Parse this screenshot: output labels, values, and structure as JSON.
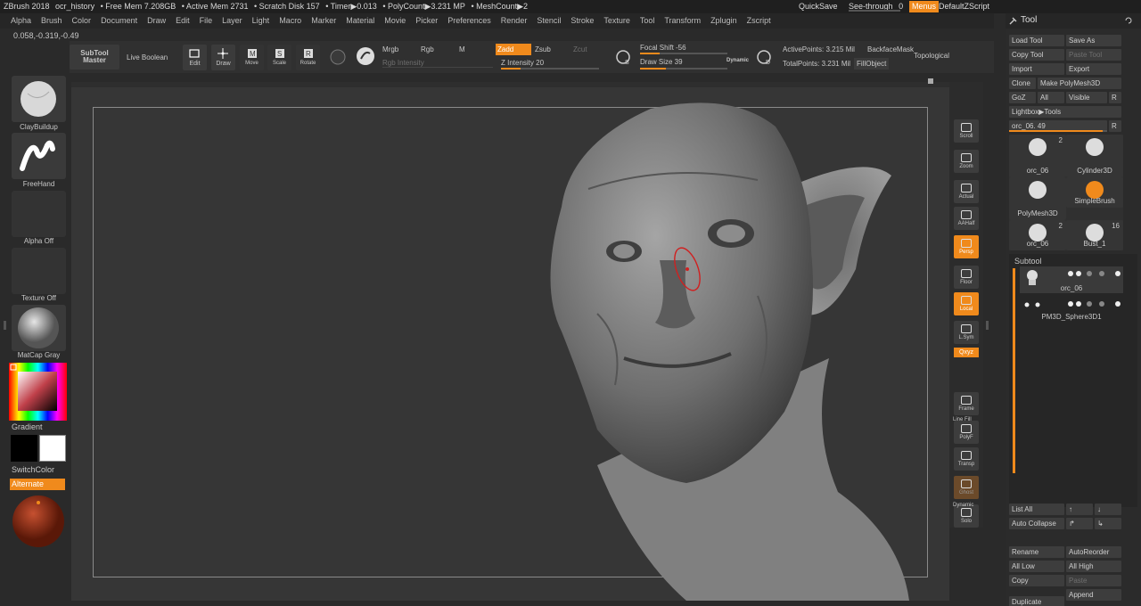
{
  "title_bar": {
    "app": "ZBrush 2018",
    "doc": "ocr_history",
    "free_mem": "• Free Mem 7.208GB",
    "active_mem": "• Active Mem 2731",
    "scratch": "• Scratch Disk 157",
    "timer": "• Timer▶0.013",
    "polycount": "• PolyCount▶3.231 MP",
    "meshcount": "• MeshCount▶2",
    "quicksave": "QuickSave",
    "see_through": "See-through",
    "see_through_val": "0",
    "menus": "Menus",
    "default_zscript": "DefaultZScript"
  },
  "menu_items": [
    "Alpha",
    "Brush",
    "Color",
    "Document",
    "Draw",
    "Edit",
    "File",
    "Layer",
    "Light",
    "Macro",
    "Marker",
    "Material",
    "Movie",
    "Picker",
    "Preferences",
    "Render",
    "Stencil",
    "Stroke",
    "Texture",
    "Tool",
    "Transform",
    "Zplugin",
    "Zscript"
  ],
  "coords": "0.058,-0.319,-0.49",
  "toolbar": {
    "subtool_master": "SubTool Master",
    "live_boolean": "Live Boolean",
    "edit": "Edit",
    "draw": "Draw",
    "move": "Move",
    "scale": "Scale",
    "rotate": "Rotate",
    "mrgb": "Mrgb",
    "rgb": "Rgb",
    "m": "M",
    "rgb_intensity": "Rgb Intensity",
    "zadd": "Zadd",
    "zsub": "Zsub",
    "zcut": "Zcut",
    "z_intensity": "Z Intensity 20",
    "focal_shift": "Focal Shift -56",
    "draw_size": "Draw Size 39",
    "dynamic": "Dynamic",
    "active_points": "ActivePoints: 3.215 Mil",
    "backface_mask": "BackfaceMask",
    "total_points": "TotalPoints: 3.231 Mil",
    "fill_object": "FillObject",
    "topological": "Topological"
  },
  "left_panel": {
    "brush1": "ClayBuildup",
    "brush2": "FreeHand",
    "alpha": "Alpha Off",
    "texture": "Texture Off",
    "material": "MatCap Gray",
    "gradient": "Gradient",
    "switch_color": "SwitchColor",
    "alternate": "Alternate"
  },
  "right_tools": [
    "Scroll",
    "Zoom",
    "Actual",
    "AAHalf",
    "Persp",
    "Floor",
    "Local",
    "L.Sym",
    "Frame",
    "PolyF",
    "Transp",
    "Ghost",
    "Solo"
  ],
  "right_tools_extra": {
    "dynamic": "Dynamic",
    "xyz": "Qxyz",
    "line_fill": "Line Fill"
  },
  "tool_panel": {
    "header": "Tool",
    "load_tool": "Load Tool",
    "save_as": "Save As",
    "copy_tool": "Copy Tool",
    "paste_tool": "Paste Tool",
    "import": "Import",
    "export": "Export",
    "clone": "Clone",
    "make_polymesh": "Make PolyMesh3D",
    "goz": "GoZ",
    "all": "All",
    "visible": "Visible",
    "r": "R",
    "lightbox_tools": "Lightbox▶Tools",
    "tool_slider": "orc_06. 49",
    "thumbs": [
      {
        "label": "orc_06",
        "count": "2"
      },
      {
        "label": "Cylinder3D",
        "count": ""
      },
      {
        "label": "PolyMesh3D",
        "count": ""
      },
      {
        "label": "SimpleBrush",
        "count": ""
      },
      {
        "label": "orc_06",
        "count": "2"
      },
      {
        "label": "Bust_1",
        "count": "16"
      }
    ],
    "subtool_header": "Subtool",
    "subtools": [
      "orc_06",
      "PM3D_Sphere3D1"
    ],
    "list_all": "List All",
    "auto_collapse": "Auto Collapse",
    "rename": "Rename",
    "auto_reorder": "AutoReorder",
    "all_low": "All Low",
    "all_high": "All High",
    "copy": "Copy",
    "paste": "Paste",
    "append": "Append",
    "duplicate": "Duplicate"
  }
}
